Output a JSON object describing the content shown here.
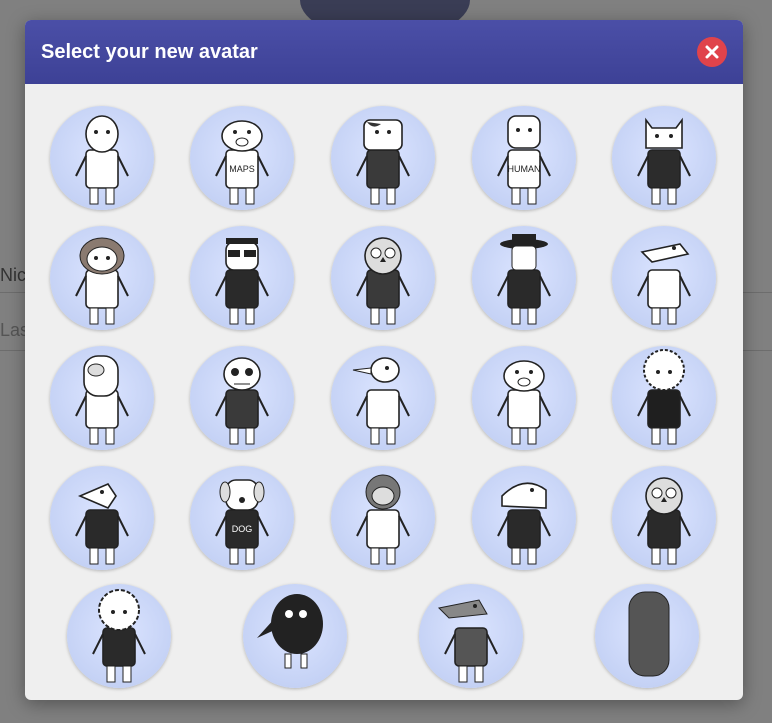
{
  "background": {
    "label_1": "Nic",
    "label_2": "Las"
  },
  "modal": {
    "title": "Select your new avatar",
    "close_icon": "close-icon",
    "avatars": [
      {
        "name": "avatar-bald-man",
        "shirt": "#ffffff",
        "head": "round"
      },
      {
        "name": "avatar-pig-maps",
        "shirt": "#ffffff",
        "text": "MAPS",
        "head": "pig"
      },
      {
        "name": "avatar-cow",
        "shirt": "#3a3a3a",
        "head": "cow"
      },
      {
        "name": "avatar-human-tshirt",
        "shirt": "#ffffff",
        "text": "HUMAN",
        "head": "square"
      },
      {
        "name": "avatar-cat-heart",
        "shirt": "#2c2c2c",
        "head": "cat"
      },
      {
        "name": "avatar-girl-bob",
        "shirt": "#ffffff",
        "head": "girl"
      },
      {
        "name": "avatar-sunglasses",
        "shirt": "#2a2a2a",
        "head": "glasses"
      },
      {
        "name": "avatar-owl",
        "shirt": "#3a3a3a",
        "head": "owl"
      },
      {
        "name": "avatar-hat-suit",
        "shirt": "#2a2a2a",
        "head": "hat"
      },
      {
        "name": "avatar-crocodile",
        "shirt": "#ffffff",
        "head": "croc"
      },
      {
        "name": "avatar-eyepatch",
        "shirt": "#ffffff",
        "head": "patch"
      },
      {
        "name": "avatar-skull",
        "shirt": "#3a3a3a",
        "head": "skull"
      },
      {
        "name": "avatar-bird-scarf",
        "shirt": "#ffffff",
        "head": "bird"
      },
      {
        "name": "avatar-fat-pig",
        "shirt": "#ffffff",
        "head": "pig"
      },
      {
        "name": "avatar-curly-xray",
        "shirt": "#1f1f1f",
        "head": "curly"
      },
      {
        "name": "avatar-mouse-dots",
        "shirt": "#2a2a2a",
        "head": "mouse"
      },
      {
        "name": "avatar-dog",
        "shirt": "#2a2a2a",
        "text": "DOG",
        "head": "dog"
      },
      {
        "name": "avatar-monkey-hoodie",
        "shirt": "#ffffff",
        "head": "monkey"
      },
      {
        "name": "avatar-fish-sweater",
        "shirt": "#2a2a2a",
        "head": "fish"
      },
      {
        "name": "avatar-owl-zigzag",
        "shirt": "#2a2a2a",
        "head": "owl"
      },
      {
        "name": "avatar-sheep",
        "shirt": "#2a2a2a",
        "head": "sheep"
      },
      {
        "name": "avatar-crow",
        "shirt": "#1f1f1f",
        "head": "crow"
      },
      {
        "name": "avatar-wolf",
        "shirt": "#555555",
        "head": "wolf"
      },
      {
        "name": "avatar-checkered-blob",
        "shirt": "#444444",
        "head": "blob"
      }
    ]
  }
}
